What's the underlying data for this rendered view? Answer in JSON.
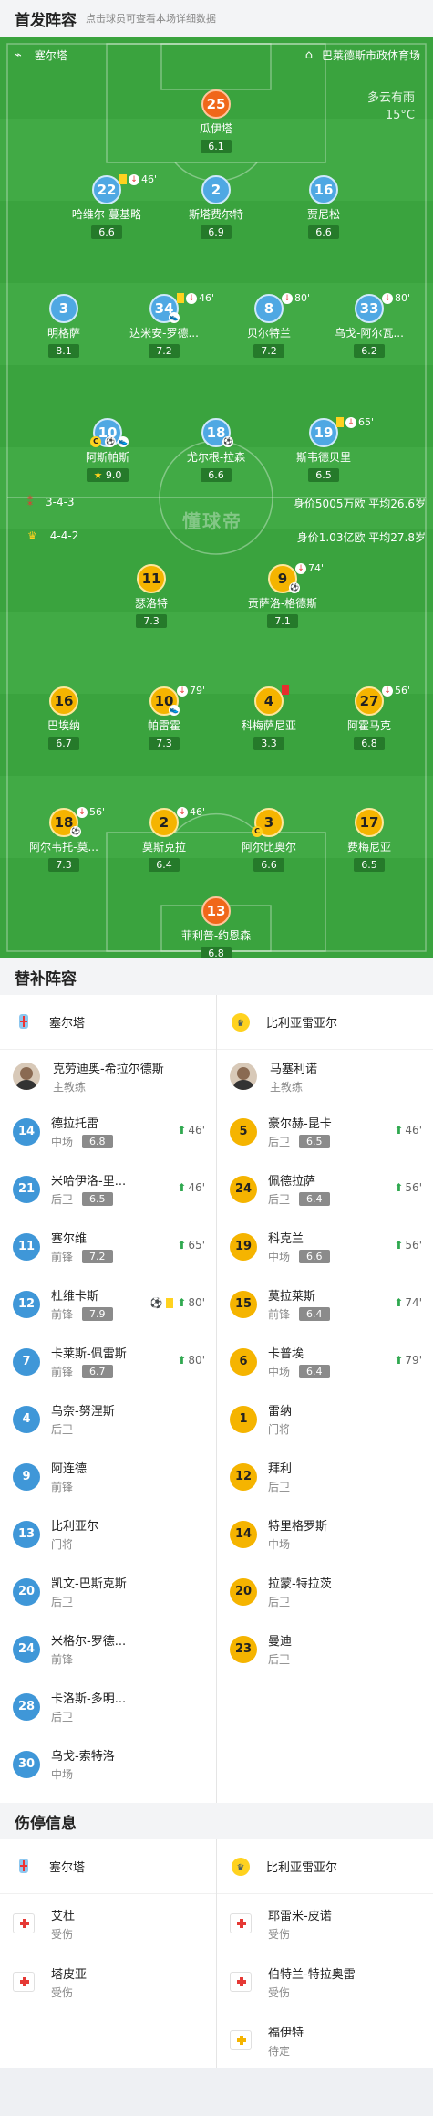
{
  "header": {
    "title": "首发阵容",
    "subtitle": "点击球员可查看本场详细数据"
  },
  "pitch": {
    "home_team": "塞尔塔",
    "venue": "巴莱德斯市政体育场",
    "weather": "多云有雨",
    "temperature": "15°C",
    "watermark": "懂球帝",
    "home": {
      "formation": "3-4-3",
      "stats": "身价5005万欧  平均26.6岁"
    },
    "away": {
      "formation": "4-4-2",
      "stats": "身价1.03亿欧  平均27.8岁"
    }
  },
  "players": [
    {
      "num": "25",
      "name": "瓜伊塔",
      "rating": "6.1",
      "color": "orange"
    },
    {
      "num": "22",
      "name": "哈维尔-蔓基略",
      "rating": "6.6",
      "color": "blue",
      "ev_text": "46'",
      "yc": true,
      "out": true
    },
    {
      "num": "2",
      "name": "斯塔费尔特",
      "rating": "6.9",
      "color": "blue"
    },
    {
      "num": "16",
      "name": "贾尼松",
      "rating": "6.6",
      "color": "blue"
    },
    {
      "num": "3",
      "name": "明格萨",
      "rating": "8.1",
      "color": "blue"
    },
    {
      "num": "34",
      "name": "达米安-罗德...",
      "rating": "7.2",
      "color": "blue",
      "ev_text": "46'",
      "yc": true,
      "out": true,
      "assist": true
    },
    {
      "num": "8",
      "name": "贝尔特兰",
      "rating": "7.2",
      "color": "blue",
      "ev_text": "80'",
      "out": true
    },
    {
      "num": "33",
      "name": "乌戈-阿尔瓦...",
      "rating": "6.2",
      "color": "blue",
      "ev_text": "80'",
      "out": true
    },
    {
      "num": "10",
      "name": "阿斯帕斯",
      "rating": "9.0",
      "color": "blue",
      "cap": true,
      "goal": true,
      "assist": true,
      "star": true
    },
    {
      "num": "18",
      "name": "尤尔根-拉森",
      "rating": "6.6",
      "color": "blue",
      "goal": true
    },
    {
      "num": "19",
      "name": "斯韦德贝里",
      "rating": "6.5",
      "color": "blue",
      "ev_text": "65'",
      "yc": true,
      "out": true
    },
    {
      "num": "11",
      "name": "瑟洛特",
      "rating": "7.3",
      "color": "yellow"
    },
    {
      "num": "9",
      "name": "贡萨洛-格德斯",
      "rating": "7.1",
      "color": "yellow",
      "ev_text": "74'",
      "out": true,
      "goal": true
    },
    {
      "num": "16",
      "name": "巴埃纳",
      "rating": "6.7",
      "color": "yellow"
    },
    {
      "num": "10",
      "name": "帕雷霍",
      "rating": "7.3",
      "color": "yellow",
      "ev_text": "79'",
      "out": true,
      "assist": true
    },
    {
      "num": "4",
      "name": "科梅萨尼亚",
      "rating": "3.3",
      "color": "yellow",
      "rc": true
    },
    {
      "num": "27",
      "name": "阿霍马克",
      "rating": "6.8",
      "color": "yellow",
      "ev_text": "56'",
      "out": true
    },
    {
      "num": "18",
      "name": "阿尔韦托-莫...",
      "rating": "7.3",
      "color": "yellow",
      "ev_text": "56'",
      "out": true,
      "goal": true
    },
    {
      "num": "2",
      "name": "莫斯克拉",
      "rating": "6.4",
      "color": "yellow",
      "ev_text": "46'",
      "out": true
    },
    {
      "num": "3",
      "name": "阿尔比奥尔",
      "rating": "6.6",
      "color": "yellow",
      "cap": true
    },
    {
      "num": "17",
      "name": "费梅尼亚",
      "rating": "6.5",
      "color": "yellow"
    },
    {
      "num": "13",
      "name": "菲利普-约恩森",
      "rating": "6.8",
      "color": "orange"
    }
  ],
  "subs": {
    "title": "替补阵容",
    "home_team": "塞尔塔",
    "away_team": "比利亚雷亚尔",
    "home_coach": {
      "name": "克劳迪奥-希拉尔德斯",
      "role": "主教练"
    },
    "away_coach": {
      "name": "马塞利诺",
      "role": "主教练"
    },
    "home": [
      {
        "num": "14",
        "name": "德拉托雷",
        "pos": "中场",
        "rating": "6.8",
        "in": "46'"
      },
      {
        "num": "21",
        "name": "米哈伊洛-里...",
        "pos": "后卫",
        "rating": "6.5",
        "in": "46'"
      },
      {
        "num": "11",
        "name": "塞尔维",
        "pos": "前锋",
        "rating": "7.2",
        "in": "65'"
      },
      {
        "num": "12",
        "name": "杜维卡斯",
        "pos": "前锋",
        "rating": "7.9",
        "in": "80'",
        "goal": true,
        "yc": true
      },
      {
        "num": "7",
        "name": "卡莱斯-佩雷斯",
        "pos": "前锋",
        "rating": "6.7",
        "in": "80'"
      },
      {
        "num": "4",
        "name": "乌奈-努涅斯",
        "pos": "后卫"
      },
      {
        "num": "9",
        "name": "阿连德",
        "pos": "前锋"
      },
      {
        "num": "13",
        "name": "比利亚尔",
        "pos": "门将"
      },
      {
        "num": "20",
        "name": "凯文-巴斯克斯",
        "pos": "后卫"
      },
      {
        "num": "24",
        "name": "米格尔-罗德...",
        "pos": "前锋"
      },
      {
        "num": "28",
        "name": "卡洛斯-多明...",
        "pos": "后卫"
      },
      {
        "num": "30",
        "name": "乌戈-索特洛",
        "pos": "中场"
      }
    ],
    "away": [
      {
        "num": "5",
        "name": "豪尔赫-昆卡",
        "pos": "后卫",
        "rating": "6.5",
        "in": "46'"
      },
      {
        "num": "24",
        "name": "佩德拉萨",
        "pos": "后卫",
        "rating": "6.4",
        "in": "56'"
      },
      {
        "num": "19",
        "name": "科克兰",
        "pos": "中场",
        "rating": "6.6",
        "in": "56'"
      },
      {
        "num": "15",
        "name": "莫拉莱斯",
        "pos": "前锋",
        "rating": "6.4",
        "in": "74'"
      },
      {
        "num": "6",
        "name": "卡普埃",
        "pos": "中场",
        "rating": "6.4",
        "in": "79'"
      },
      {
        "num": "1",
        "name": "雷纳",
        "pos": "门将"
      },
      {
        "num": "12",
        "name": "拜利",
        "pos": "后卫"
      },
      {
        "num": "14",
        "name": "特里格罗斯",
        "pos": "中场"
      },
      {
        "num": "20",
        "name": "拉蒙-特拉茨",
        "pos": "后卫"
      },
      {
        "num": "23",
        "name": "曼迪",
        "pos": "后卫"
      }
    ]
  },
  "injuries": {
    "title": "伤停信息",
    "home_team": "塞尔塔",
    "away_team": "比利亚雷亚尔",
    "home": [
      {
        "name": "艾杜",
        "status": "受伤"
      },
      {
        "name": "塔皮亚",
        "status": "受伤"
      }
    ],
    "away": [
      {
        "name": "耶雷米-皮诺",
        "status": "受伤"
      },
      {
        "name": "伯特兰-特拉奥雷",
        "status": "受伤"
      },
      {
        "name": "福伊特",
        "status": "待定",
        "pending": true
      }
    ]
  }
}
